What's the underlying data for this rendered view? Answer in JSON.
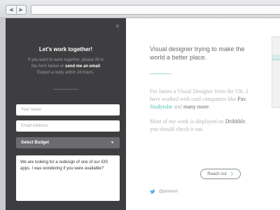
{
  "browser": {
    "nav_back_icon": "triangle-left",
    "nav_forward_icon": "triangle-right"
  },
  "contact_panel": {
    "title": "Let's work together!",
    "intro_line_1": "If you want to work together, please fill in",
    "intro_line_2_pre": "the form below or ",
    "intro_line_2_bold": "send me an email",
    "intro_line_3": "Expect a reply within 24 hours.",
    "name_placeholder": "Your name",
    "email_placeholder": "Email Address",
    "budget_select": "Select Budget",
    "message": "We are looking for a redesign of one of our iOS apps. I was wondering if you were available?"
  },
  "main": {
    "headline": "Visual designer trying to make the world a better place.",
    "bio_1_pre": "I'm James a Visual Designer from the UK. I have worked with cool companies like ",
    "bio_1_link1": "Pav",
    "bio_1_sep": ", ",
    "bio_1_link2": "Studytube",
    "bio_1_and": " and ",
    "bio_1_more": "many more",
    "bio_1_end": ".",
    "bio_2_pre": "Most of my work is displayed on ",
    "bio_2_bold": "Dribbble",
    "bio_2_end": ", you should check it out.",
    "twitter_handle": "@jamesm",
    "reach_out": "Reach out"
  },
  "colors": {
    "accent": "#4fbfb5",
    "panel_bg": "#3e3e40",
    "twitter_blue": "#55acee"
  }
}
